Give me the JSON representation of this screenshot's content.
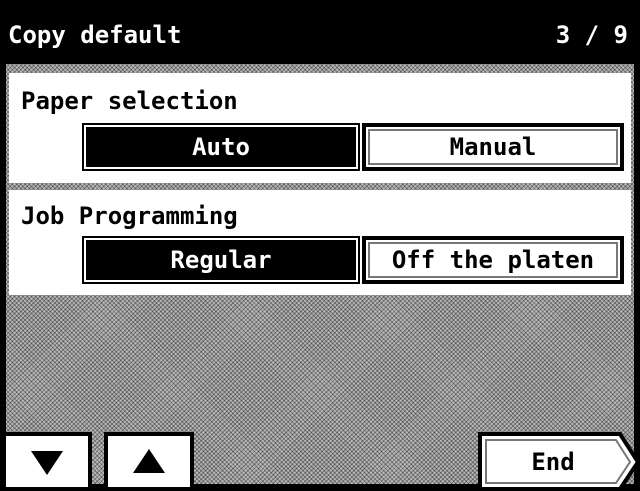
{
  "header": {
    "title": "Copy default",
    "page_indicator": "3 / 9"
  },
  "settings": [
    {
      "label": "Paper selection",
      "options": [
        {
          "label": "Auto",
          "selected": true
        },
        {
          "label": "Manual",
          "selected": false
        }
      ]
    },
    {
      "label": "Job Programming",
      "options": [
        {
          "label": "Regular",
          "selected": true
        },
        {
          "label": "Off the platen",
          "selected": false
        }
      ]
    }
  ],
  "footer": {
    "down_icon": "down-triangle-icon",
    "up_icon": "up-triangle-icon",
    "end_label": "End"
  }
}
